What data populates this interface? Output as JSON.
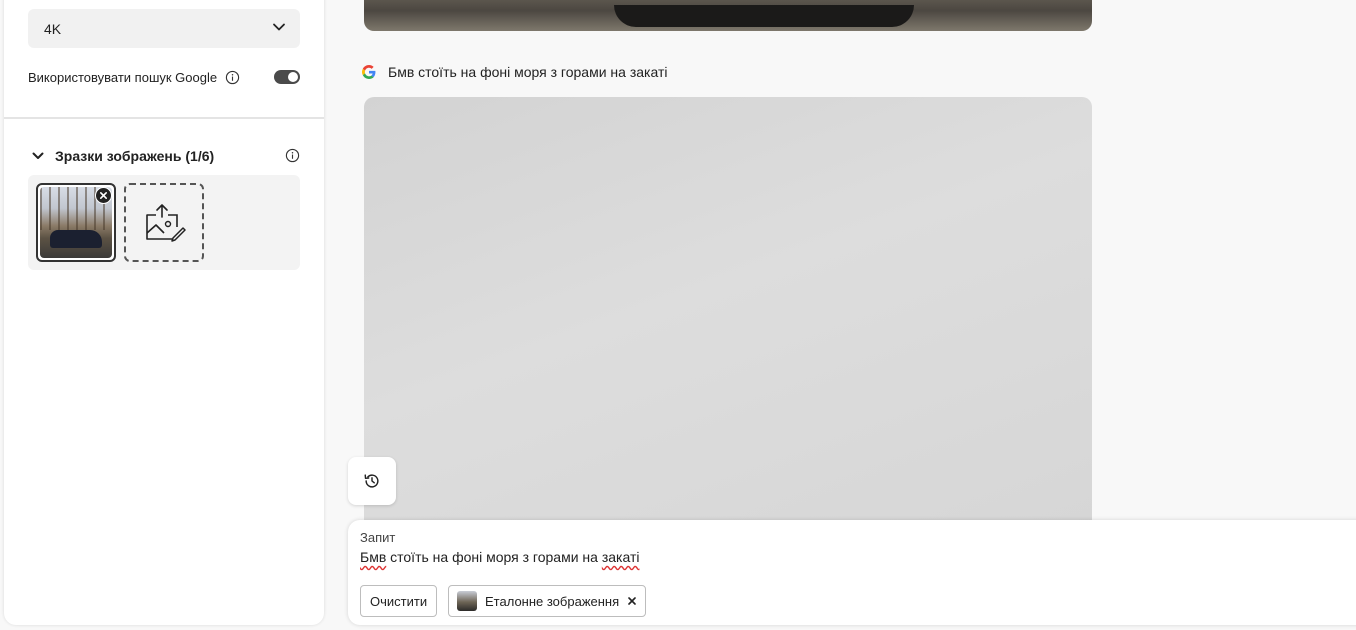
{
  "settings": {
    "resolution_value": "4K",
    "google_search_label": "Використовувати пошук Google",
    "google_search_enabled": true
  },
  "samples": {
    "title": "Зразки зображень (1/6)",
    "selected_count": 1,
    "max_count": 6
  },
  "main": {
    "prompt_line": "Бмв стоїть на фоні моря з горами на закаті"
  },
  "prompt_panel": {
    "label": "Запит",
    "value_word_1": "Бмв",
    "value_middle": " стоїть на фоні моря з горами на ",
    "value_word_last": "закаті",
    "clear_label": "Очистити",
    "reference_chip_label": "Еталонне зображення"
  },
  "icons": {
    "dropdown": "chevron-down-icon",
    "info": "info-icon",
    "collapse": "chevron-down-icon",
    "remove": "close-icon",
    "upload": "image-upload-icon",
    "google": "google-icon",
    "history": "history-icon"
  },
  "colors": {
    "toggle_on": "#4a4a4a",
    "panel_bg": "#ffffff",
    "page_bg": "#f8f8f8",
    "spell_error": "#dd3333"
  }
}
